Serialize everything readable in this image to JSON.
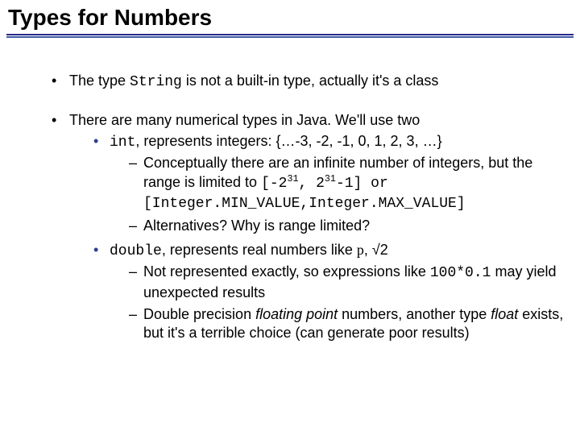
{
  "title": "Types for Numbers",
  "body": {
    "b1_pre": "The type ",
    "b1_code": "String",
    "b1_post": " is not a built-in type, actually it's a class",
    "b2_text": "There are many numerical types in Java.  We'll use two",
    "b2_1_code": "int",
    "b2_1_post": ", represents integers: {…-3, -2, -1, 0, 1, 2, 3, …}",
    "b2_1_a_pre": "Conceptually there are an infinite number of integers, but the range is limited to ",
    "b2_1_a_code1a": "[-2",
    "b2_1_a_code1b": ", 2",
    "b2_1_a_code1c": "-1] or [Integer.MIN_VALUE,Integer.MAX_VALUE]",
    "b2_1_a_sup": "31",
    "b2_1_b_text": "Alternatives? Why is range limited?",
    "b2_2_code": "double",
    "b2_2_mid": ", represents real numbers like  ",
    "b2_2_pi": "p",
    "b2_2_after_pi": ", √2",
    "b2_2_a_pre": "Not represented exactly, so expressions like ",
    "b2_2_a_code": "100*0.1",
    "b2_2_a_post": " may yield unexpected results",
    "b2_2_b_pre": "Double precision ",
    "b2_2_b_em1": "floating point",
    "b2_2_b_mid": " numbers, another type ",
    "b2_2_b_em2": "float",
    "b2_2_b_post": " exists, but it's a terrible choice (can generate poor results)"
  }
}
